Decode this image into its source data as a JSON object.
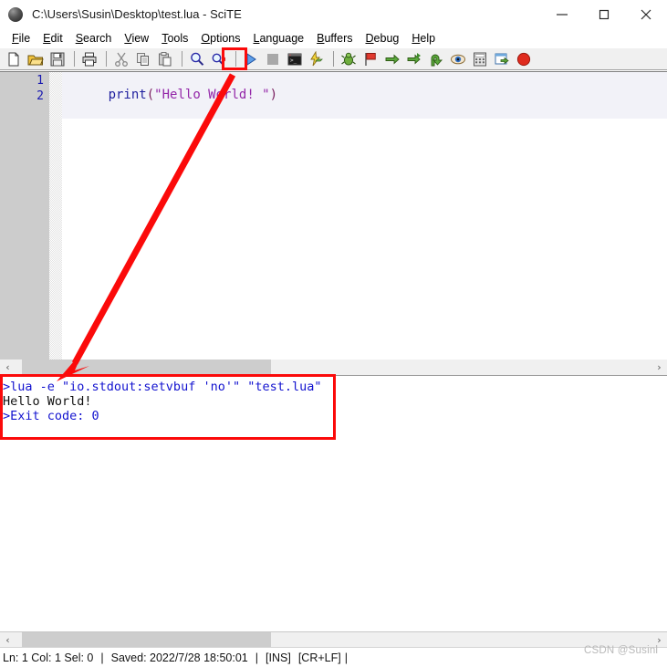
{
  "window": {
    "title": "C:\\Users\\Susin\\Desktop\\test.lua - SciTE",
    "app_icon": "scite-ball-icon",
    "controls": {
      "minimize": "minimize-icon",
      "maximize": "maximize-icon",
      "close": "close-icon"
    }
  },
  "menubar": {
    "items": [
      {
        "label": "File",
        "accel": "F"
      },
      {
        "label": "Edit",
        "accel": "E"
      },
      {
        "label": "Search",
        "accel": "S"
      },
      {
        "label": "View",
        "accel": "V"
      },
      {
        "label": "Tools",
        "accel": "T"
      },
      {
        "label": "Options",
        "accel": "O"
      },
      {
        "label": "Language",
        "accel": "L"
      },
      {
        "label": "Buffers",
        "accel": "B"
      },
      {
        "label": "Debug",
        "accel": "D"
      },
      {
        "label": "Help",
        "accel": "H"
      }
    ]
  },
  "toolbar": {
    "items": [
      {
        "name": "new-file-icon",
        "title": "New"
      },
      {
        "name": "open-file-icon",
        "title": "Open"
      },
      {
        "name": "save-file-icon",
        "title": "Save"
      },
      {
        "name": "separator",
        "title": ""
      },
      {
        "name": "print-icon",
        "title": "Print"
      },
      {
        "name": "separator",
        "title": ""
      },
      {
        "name": "cut-icon",
        "title": "Cut"
      },
      {
        "name": "copy-icon",
        "title": "Copy"
      },
      {
        "name": "paste-icon",
        "title": "Paste"
      },
      {
        "name": "separator",
        "title": ""
      },
      {
        "name": "find-icon",
        "title": "Find"
      },
      {
        "name": "replace-icon",
        "title": "Replace"
      },
      {
        "name": "separator",
        "title": ""
      },
      {
        "name": "run-icon",
        "title": "Go / Run"
      },
      {
        "name": "stop-icon",
        "title": "Stop Executing"
      },
      {
        "name": "console-icon",
        "title": "Console"
      },
      {
        "name": "build-icon",
        "title": "Build"
      },
      {
        "name": "separator",
        "title": ""
      },
      {
        "name": "bug-icon",
        "title": "Debug"
      },
      {
        "name": "breakpoint-flag-icon",
        "title": "Toggle Breakpoint"
      },
      {
        "name": "step-over-icon",
        "title": "Step Over"
      },
      {
        "name": "step-into-icon",
        "title": "Step Into"
      },
      {
        "name": "step-out-icon",
        "title": "Step Out"
      },
      {
        "name": "watch-icon",
        "title": "Watch"
      },
      {
        "name": "calculator-icon",
        "title": "Evaluate"
      },
      {
        "name": "window-export-icon",
        "title": "Output Window"
      },
      {
        "name": "stop-debug-icon",
        "title": "Stop Debugging"
      }
    ]
  },
  "editor": {
    "line_numbers": [
      "1",
      "2"
    ],
    "lines": [
      {
        "number": "1",
        "tokens": [
          {
            "text": "print",
            "kind": "func"
          },
          {
            "text": "(",
            "kind": "paren"
          },
          {
            "text": "\"Hello World! \"",
            "kind": "string"
          },
          {
            "text": ")",
            "kind": "paren"
          }
        ]
      },
      {
        "number": "2",
        "tokens": []
      }
    ],
    "scrollbar": {
      "left_arrow": "‹",
      "right_arrow": "›"
    }
  },
  "output": {
    "lines": [
      {
        "text": ">lua -e \"io.stdout:setvbuf 'no'\" \"test.lua\"",
        "kind": "cmd"
      },
      {
        "text": "Hello World!",
        "kind": "text"
      },
      {
        "text": ">Exit code: 0",
        "kind": "cmd"
      }
    ],
    "scrollbar": {
      "left_arrow": "‹",
      "right_arrow": "›"
    }
  },
  "statusbar": {
    "position": "Ln: 1 Col: 1 Sel: 0",
    "divider": "|",
    "saved": "Saved: 2022/7/28  18:50:01",
    "insert_mode": "[INS]",
    "eol_mode": "[CR+LF]",
    "trailing": "|"
  },
  "watermark": {
    "text": "CSDN @Susinl"
  },
  "annotations": {
    "run_button_highlight": "red-box-around-run-button",
    "output_highlight": "red-box-around-output",
    "arrow": "red-arrow-run-to-output",
    "color": "#fb0a0a"
  },
  "colors": {
    "accent_red": "#fb0a0a",
    "linenum_bg": "#cccccc",
    "linenum_fg": "#1818b0",
    "code_func": "#1f1f9e",
    "code_paren": "#7a2060",
    "code_string": "#9326a8",
    "output_cmd": "#1212cf",
    "output_text": "#101010",
    "toolbar_bg": "#f0f0f0"
  }
}
